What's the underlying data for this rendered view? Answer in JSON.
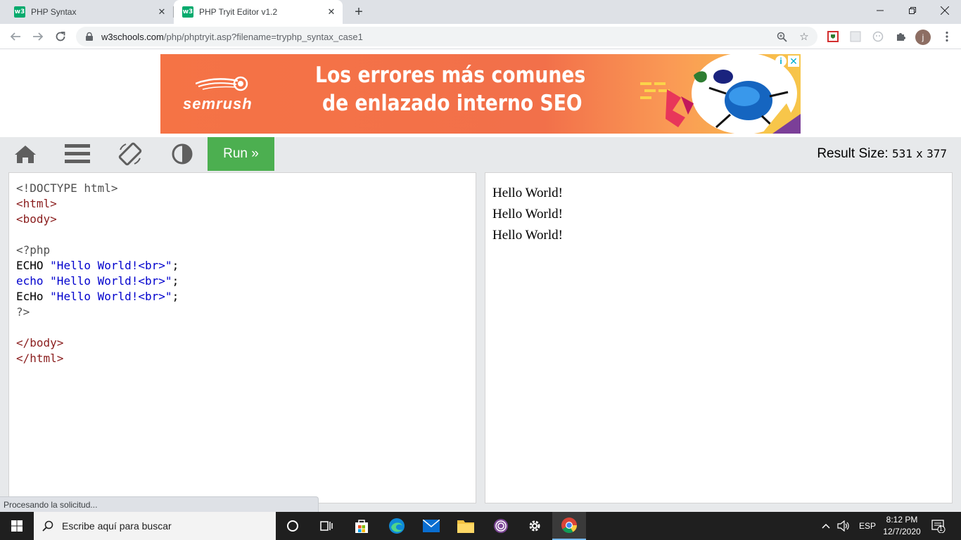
{
  "browser": {
    "tabs": [
      {
        "title": "PHP Syntax",
        "favicon": "w3"
      },
      {
        "title": "PHP Tryit Editor v1.2",
        "favicon": "w3"
      }
    ],
    "active_tab": 1,
    "url_domain": "w3schools.com",
    "url_path": "/php/phptryit.asp?filename=tryphp_syntax_case1",
    "profile_initial": "j",
    "new_tab_label": "+",
    "status_text": "Procesando la solicitud..."
  },
  "ad": {
    "brand": "semrush",
    "headline_line1": "Los errores más comunes",
    "headline_line2": "de enlazado interno SEO",
    "info_label": "i",
    "close_label": "✕"
  },
  "tryit": {
    "run_label": "Run »",
    "result_size_label": "Result Size:",
    "result_width": "531",
    "result_x": "x",
    "result_height": "377"
  },
  "code": {
    "lines": [
      "<!DOCTYPE html>",
      "<html>",
      "<body>",
      "",
      "<?php",
      "ECHO \"Hello World!<br>\";",
      "echo \"Hello World!<br>\";",
      "EcHo \"Hello World!<br>\";",
      "?>",
      "",
      "</body>",
      "</html>"
    ],
    "doctype": "<!DOCTYPE html>",
    "html_open": "<html>",
    "body_open": "<body>",
    "php_open": "<?php",
    "echo1_kw": "ECHO",
    "echo2_kw": "echo",
    "echo3_kw": "EcHo",
    "echo_string": "\"Hello World!<br>\"",
    "semicolon": ";",
    "php_close": "?>",
    "body_close": "</body>",
    "html_close": "</html>"
  },
  "result": {
    "lines": [
      "Hello World!",
      "Hello World!",
      "Hello World!"
    ]
  },
  "taskbar": {
    "search_placeholder": "Escribe aquí para buscar",
    "language": "ESP",
    "time": "8:12 PM",
    "date": "12/7/2020",
    "notification_count": "1"
  },
  "colors": {
    "run_button": "#4caf50",
    "toolbar_bg": "#e7e9eb",
    "ad_bg": "#f57345",
    "code_tag": "#8a1d1d",
    "code_string": "#0000cd"
  }
}
